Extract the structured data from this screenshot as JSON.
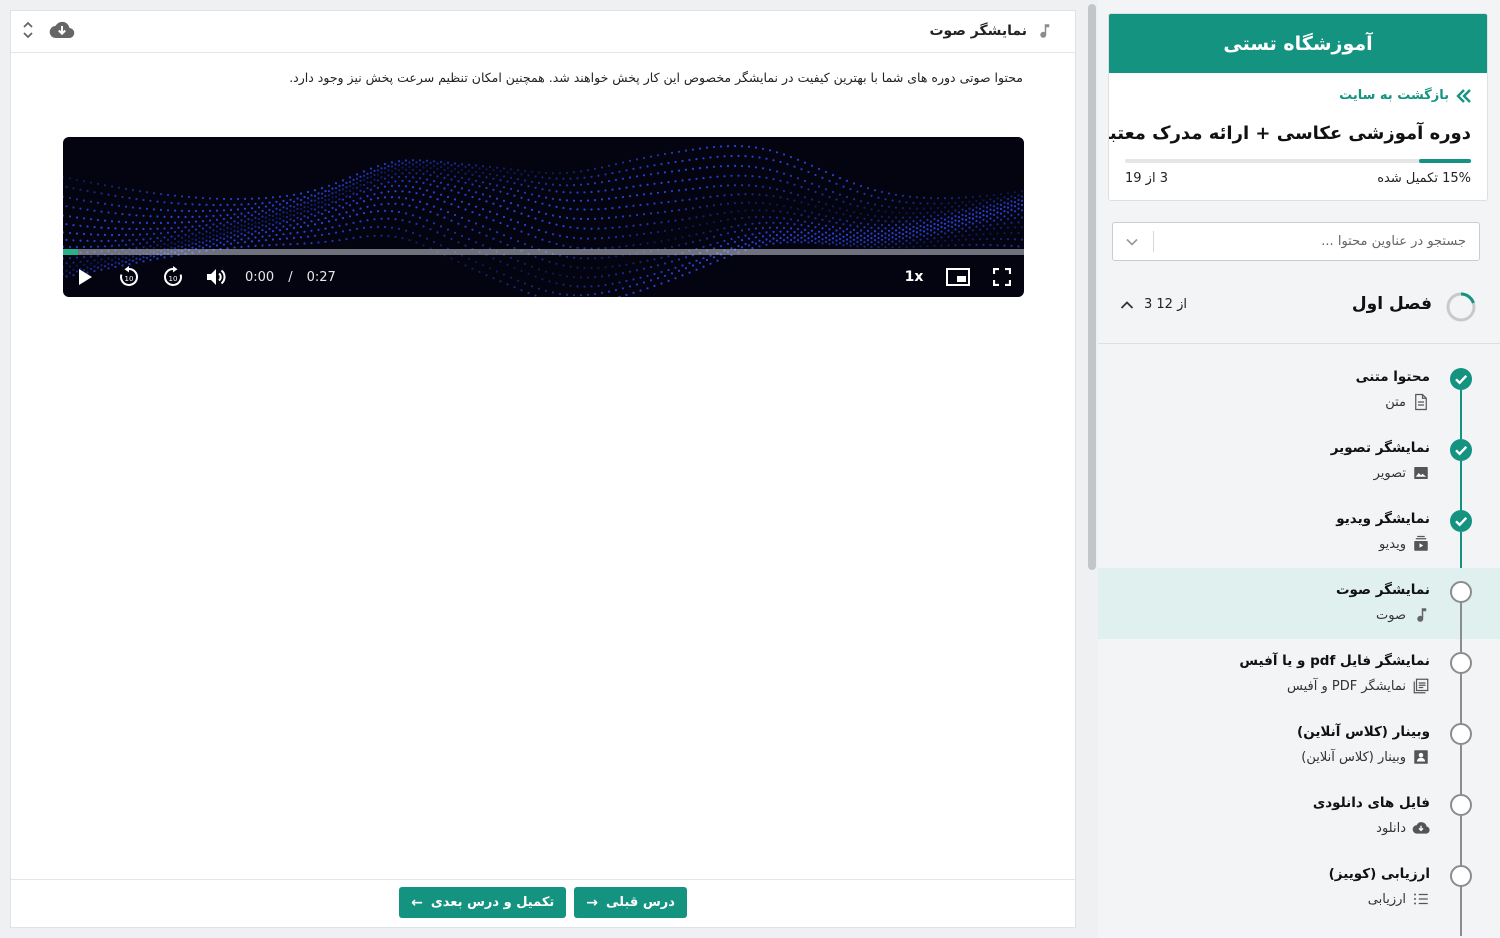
{
  "lesson": {
    "title": "نمایشگر صوت",
    "description": "محتوا صوتی دوره های شما با بهترین کیفیت در نمایشگر مخصوص این کار پخش خواهند شد. همچنین امکان تنظیم سرعت پخش نیز وجود دارد."
  },
  "player": {
    "current_time": "0:00",
    "separator": "/",
    "duration": "0:27",
    "speed": "1x",
    "progress": 0.016
  },
  "footer": {
    "prev_label": "درس قبلی",
    "next_label": "تکمیل و درس بعدی"
  },
  "sidebar": {
    "academy_name": "آموزشگاه تستی",
    "back_label": "بازگشت به سایت",
    "course_title": "دوره آموزشی عکاسی + ارائه مدرک معتبر",
    "progress_percent": 0.15,
    "progress_label": "15% تکمیل شده",
    "progress_count": "3 از 19",
    "search_placeholder": "جستجو در عناوین محتوا ...",
    "chapter": {
      "title": "فصل اول",
      "count": "3 از 12"
    },
    "items": [
      {
        "title": "محتوا متنی",
        "type": "متن",
        "icon": "document-icon",
        "done": true
      },
      {
        "title": "نمایشگر تصویر",
        "type": "تصویر",
        "icon": "image-icon",
        "done": true
      },
      {
        "title": "نمایشگر ویدیو",
        "type": "ویدیو",
        "icon": "video-icon",
        "done": true
      },
      {
        "title": "نمایشگر صوت",
        "type": "صوت",
        "icon": "music-note-icon",
        "done": false,
        "active": true
      },
      {
        "title": "نمایشگر فایل pdf و یا آفیس",
        "type": "نمایشگر PDF و آفیس",
        "icon": "pdf-document-icon",
        "done": false
      },
      {
        "title": "وبینار (کلاس آنلاین)",
        "type": "وبینار (کلاس آنلاین)",
        "icon": "webinar-icon",
        "done": false
      },
      {
        "title": "فایل های دانلودی",
        "type": "دانلود",
        "icon": "cloud-download-icon",
        "done": false
      },
      {
        "title": "ارزیابی (کوییز)",
        "type": "ارزیابی",
        "icon": "quiz-list-icon",
        "done": false
      }
    ]
  },
  "colors": {
    "brand": "#149381",
    "active_row": "#e0f0ee",
    "player_bg": "#03040f",
    "wave": "#2f4dff"
  }
}
